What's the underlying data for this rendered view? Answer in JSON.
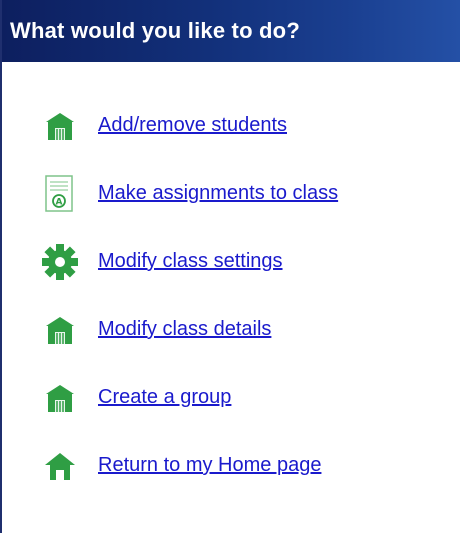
{
  "header": {
    "title": "What would you like to do?"
  },
  "menu": {
    "items": [
      {
        "label": "Add/remove students",
        "icon": "green-building-icon"
      },
      {
        "label": "Make assignments to class",
        "icon": "assignment-document-icon"
      },
      {
        "label": "Modify class settings",
        "icon": "gear-icon"
      },
      {
        "label": "Modify class details",
        "icon": "green-building-icon"
      },
      {
        "label": "Create a group",
        "icon": "green-building-icon"
      },
      {
        "label": "Return to my Home page",
        "icon": "home-icon"
      }
    ]
  },
  "colors": {
    "header_bg": "#12307a",
    "link": "#1a1acc",
    "icon_green": "#2f9e44",
    "icon_green_dark": "#1f7a33",
    "page_bg": "#ffffff"
  }
}
